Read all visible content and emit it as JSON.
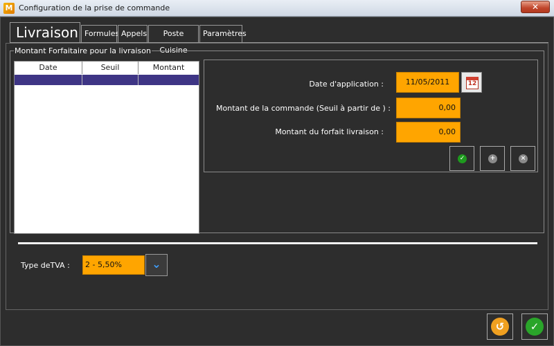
{
  "window": {
    "title": "Configuration de la prise de commande",
    "close_glyph": "✕"
  },
  "tabs": [
    {
      "label": "Livraison",
      "active": true
    },
    {
      "label": "Formules",
      "active": false
    },
    {
      "label": "Appels",
      "active": false
    },
    {
      "label": "Poste Cuisine",
      "active": false
    },
    {
      "label": "Paramètres",
      "active": false
    }
  ],
  "group": {
    "legend": "Montant Forfaitaire pour la livraison"
  },
  "grid": {
    "columns": [
      "Date",
      "Seuil",
      "Montant"
    ],
    "selected_row": [
      "",
      "",
      ""
    ]
  },
  "form": {
    "date_label": "Date d'application :",
    "date_value": "11/05/2011",
    "calendar_day": "12",
    "seuil_label": "Montant de la commande (Seuil à partir de ) :",
    "seuil_value": "0,00",
    "forfait_label": "Montant du forfait livraison :",
    "forfait_value": "0,00"
  },
  "actions": {
    "validate_glyph": "✓",
    "add_glyph": "+",
    "delete_glyph": "×"
  },
  "tva": {
    "label": "Type deTVA :",
    "value": "2 - 5,50%",
    "dropdown_glyph": "⌄"
  },
  "footer": {
    "undo_glyph": "↺",
    "ok_glyph": "✓"
  },
  "colors": {
    "field": "#ffa500",
    "selection": "#3e3585",
    "ok": "#2aa52a"
  }
}
